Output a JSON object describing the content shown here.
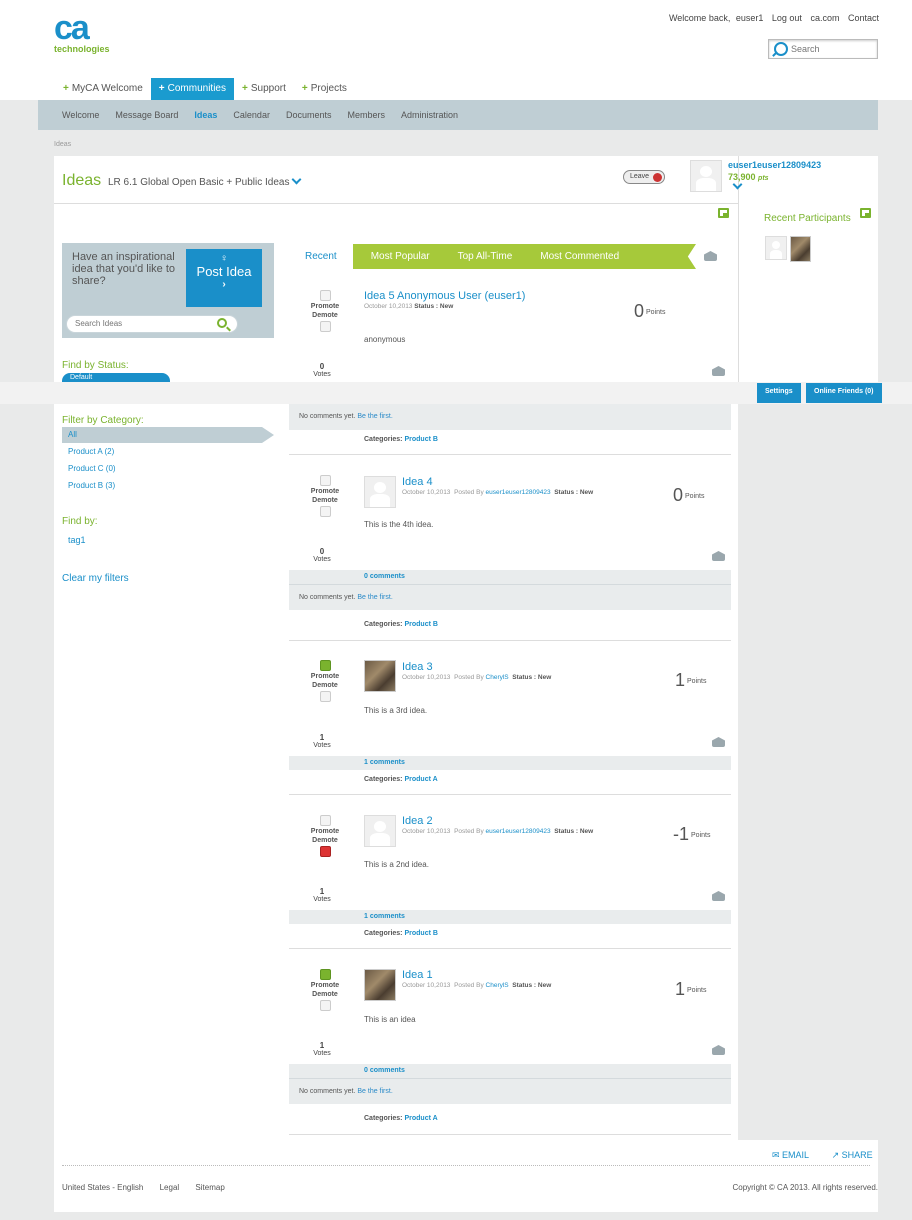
{
  "header": {
    "welcome": "Welcome back,",
    "user": "euser1",
    "logout": "Log out",
    "cacom": "ca.com",
    "contact": "Contact",
    "logo_mark": "ca",
    "logo_text": "technologies",
    "search_placeholder": "Search"
  },
  "mainnav": [
    "MyCA Welcome",
    "Communities",
    "Support",
    "Projects"
  ],
  "subnav": [
    "Welcome",
    "Message Board",
    "Ideas",
    "Calendar",
    "Documents",
    "Members",
    "Administration"
  ],
  "breadcrumb": "Ideas",
  "page": {
    "title": "Ideas",
    "subtitle": "LR 6.1 Global Open Basic + Public Ideas",
    "leave": "Leave"
  },
  "profile": {
    "name": "euser1euser12809423",
    "points": "73,900",
    "points_unit": "pts"
  },
  "right": {
    "recent_participants": "Recent Participants",
    "settings": "Settings",
    "online_friends": "Online Friends (0)"
  },
  "sidebar": {
    "prompt": "Have an inspirational idea that you'd like to share?",
    "post_idea": "Post Idea",
    "search_placeholder": "Search Ideas",
    "find_by_status": "Find by Status:",
    "status_value": "Default",
    "filter_by_category": "Filter by Category:",
    "categories": [
      "All",
      "Product A (2)",
      "Product C (0)",
      "Product B (3)"
    ],
    "find_by": "Find by:",
    "tag": "tag1",
    "clear": "Clear my filters"
  },
  "tabs": [
    "Recent",
    "Most Popular",
    "Top All-Time",
    "Most Commented"
  ],
  "labels": {
    "promote": "Promote",
    "demote": "Demote",
    "votes": "Votes",
    "points": "Points",
    "status": "Status :",
    "posted_by": "Posted By",
    "categories": "Categories:",
    "no_comments": "No comments yet.",
    "be_first": "Be the first."
  },
  "ideas": [
    {
      "title": "Idea 5 Anonymous User (euser1)",
      "date": "October 10,2013",
      "author": "",
      "status": "New",
      "body": "anonymous",
      "votes": "0",
      "points": "0",
      "comments": "",
      "category": "Product B"
    },
    {
      "title": "Idea 4",
      "date": "October 10,2013",
      "author": "euser1euser12809423",
      "status": "New",
      "body": "This is the 4th idea.",
      "votes": "0",
      "points": "0",
      "comments": "0 comments",
      "category": "Product B"
    },
    {
      "title": "Idea 3",
      "date": "October 10,2013",
      "author": "CherylS",
      "status": "New",
      "body": "This is a 3rd idea.",
      "votes": "1",
      "points": "1",
      "comments": "1 comments",
      "category": "Product A"
    },
    {
      "title": "Idea 2",
      "date": "October 10,2013",
      "author": "euser1euser12809423",
      "status": "New",
      "body": "This is a 2nd idea.",
      "votes": "1",
      "points": "-1",
      "comments": "1 comments",
      "category": "Product B"
    },
    {
      "title": "Idea 1",
      "date": "October 10,2013",
      "author": "CherylS",
      "status": "New",
      "body": "This is an idea",
      "votes": "1",
      "points": "1",
      "comments": "0 comments",
      "category": "Product A"
    }
  ],
  "footer": {
    "email": "EMAIL",
    "share": "SHARE",
    "locale": "United States - English",
    "legal": "Legal",
    "sitemap": "Sitemap",
    "copyright": "Copyright © CA 2013. All rights reserved."
  },
  "colors": {
    "brand_blue": "#1a8fc9",
    "brand_green": "#7ab32e",
    "nav_band": "#bfced4"
  }
}
